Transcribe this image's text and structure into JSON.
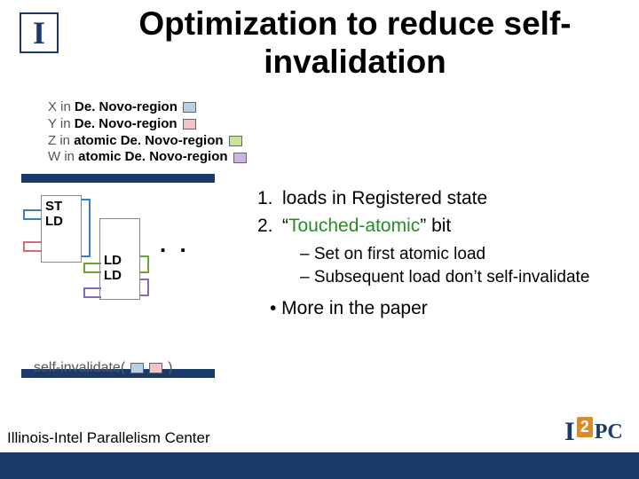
{
  "logo_letter": "I",
  "title": "Optimization to reduce self-invalidation",
  "legend": {
    "x_pre": "X in ",
    "x_bold": "De. Novo-region",
    "y_pre": "Y in ",
    "y_bold": "De. Novo-region",
    "z_pre": "Z in ",
    "z_bold": "atomic De. Novo-region",
    "w_pre": "W in ",
    "w_bold": "atomic De. Novo-region"
  },
  "diagram": {
    "col1_line1": "ST",
    "col1_line2": "LD",
    "col2_line1": "LD",
    "col2_line2": "LD",
    "dots": ". ."
  },
  "self_invalidate": {
    "prefix": "self-invalidate(",
    "suffix": ")"
  },
  "content": {
    "item1_num": "1.",
    "item1_text": "loads in Registered state",
    "item2_num": "2.",
    "item2_q1": "“",
    "item2_green": "Touched-atomic",
    "item2_q2": "”",
    "item2_rest": " bit",
    "sub1": "– Set on first atomic load",
    "sub2": "– Subsequent load don’t self-invalidate",
    "bullet": "•  More in the paper"
  },
  "footer": "Illinois-Intel Parallelism Center",
  "i2pc": {
    "i": "I",
    "two": "2",
    "pc": "PC"
  }
}
